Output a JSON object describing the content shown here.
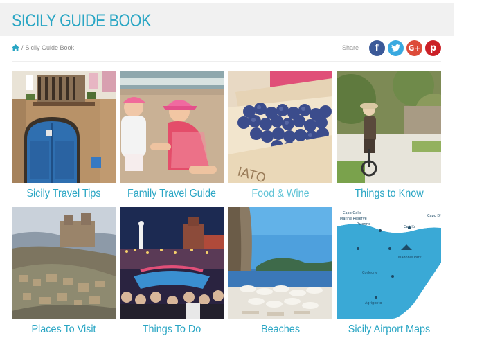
{
  "header": {
    "site_title": "SICILY GUIDE BOOK"
  },
  "breadcrumb": {
    "separator": "/",
    "current": "Sicily Guide Book"
  },
  "share": {
    "label": "Share",
    "buttons": [
      "f",
      "t",
      "G+",
      "p"
    ]
  },
  "colors": {
    "accent": "#2aa6c4",
    "facebook": "#3b5998",
    "twitter": "#39a9e0",
    "google": "#dd4b39",
    "pinterest": "#cb2027"
  },
  "tiles": [
    {
      "label": "Sicily Travel Tips"
    },
    {
      "label": "Family Travel Guide"
    },
    {
      "label": "Food & Wine"
    },
    {
      "label": "Things to Know"
    },
    {
      "label": "Places To Visit"
    },
    {
      "label": "Things To Do"
    },
    {
      "label": "Beaches"
    },
    {
      "label": "Sicily Airport Maps"
    }
  ]
}
